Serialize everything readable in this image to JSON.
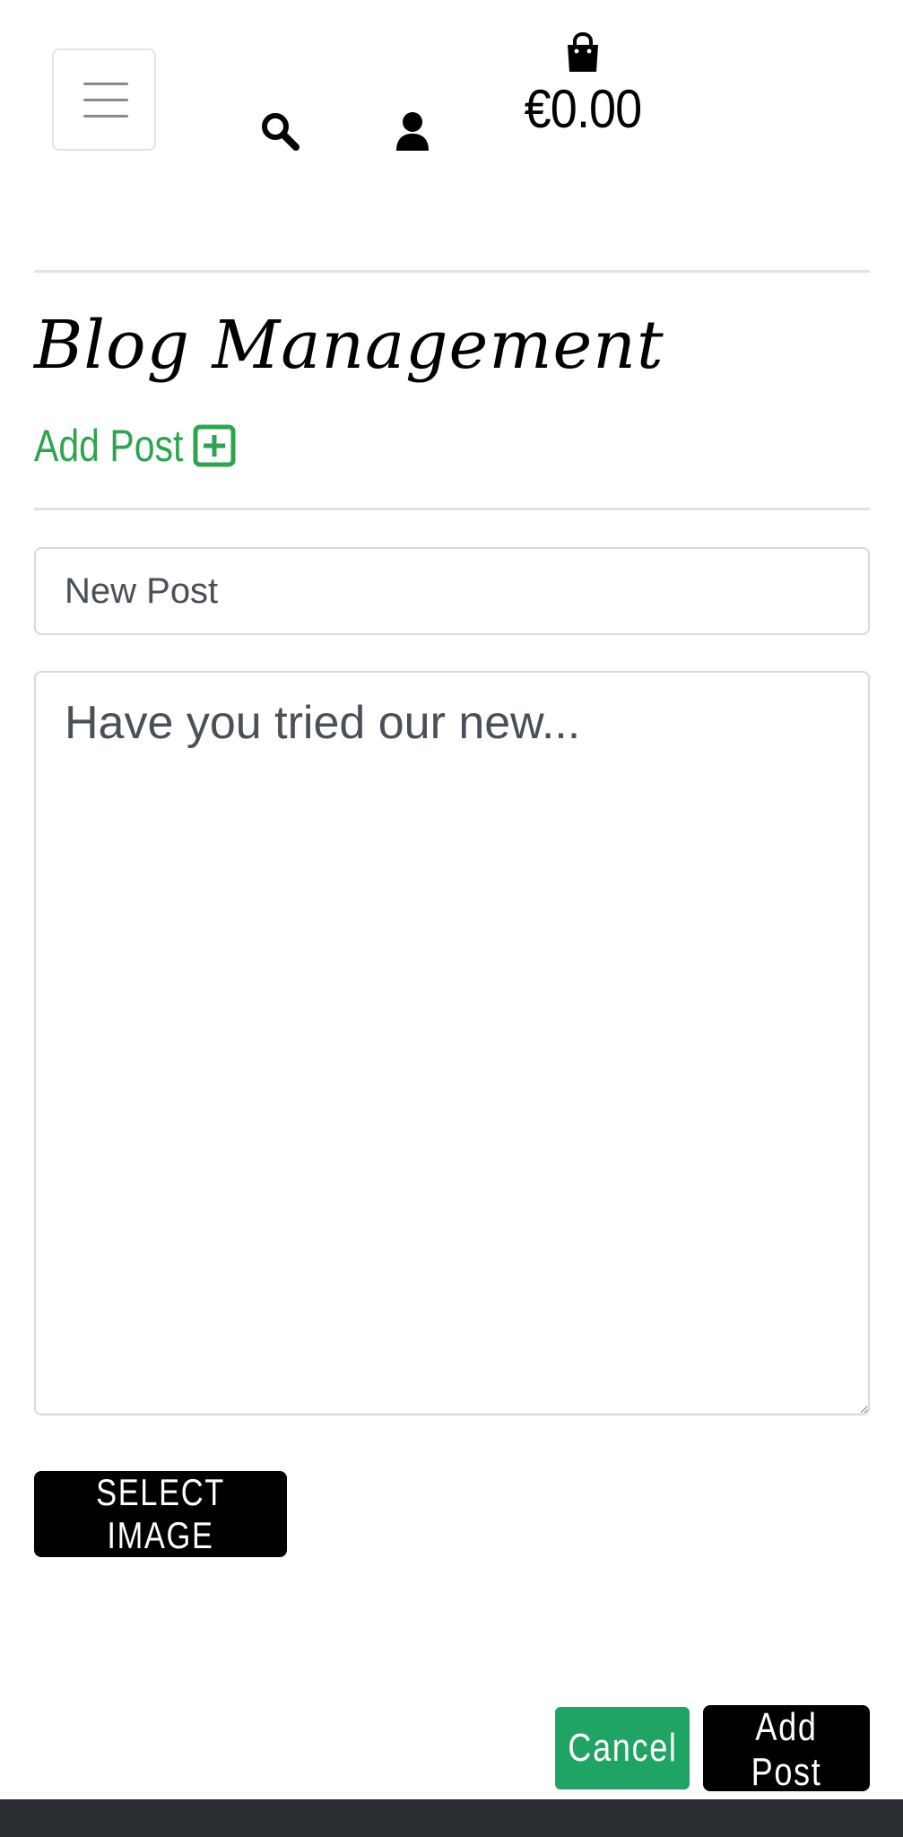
{
  "header": {
    "menu_icon": "hamburger-icon",
    "search_icon": "search-icon",
    "account_icon": "user-icon",
    "bag_icon": "shopping-bag-icon",
    "cart_total": "€0.00"
  },
  "main": {
    "title": "Blog Management",
    "add_post_link": "Add Post",
    "add_post_icon": "plus-square-icon",
    "title_input": {
      "placeholder": "New Post",
      "value": ""
    },
    "body_textarea": {
      "placeholder": "Have you tried our new...",
      "value": ""
    },
    "select_image_label": "SELECT IMAGE",
    "cancel_label": "Cancel",
    "submit_label": "Add Post"
  },
  "colors": {
    "accent_green": "#2ea44f",
    "cancel_green": "#1fa463",
    "button_black": "#000000",
    "border_gray": "#d9d9d9",
    "footer_dark": "#2b2e33"
  }
}
